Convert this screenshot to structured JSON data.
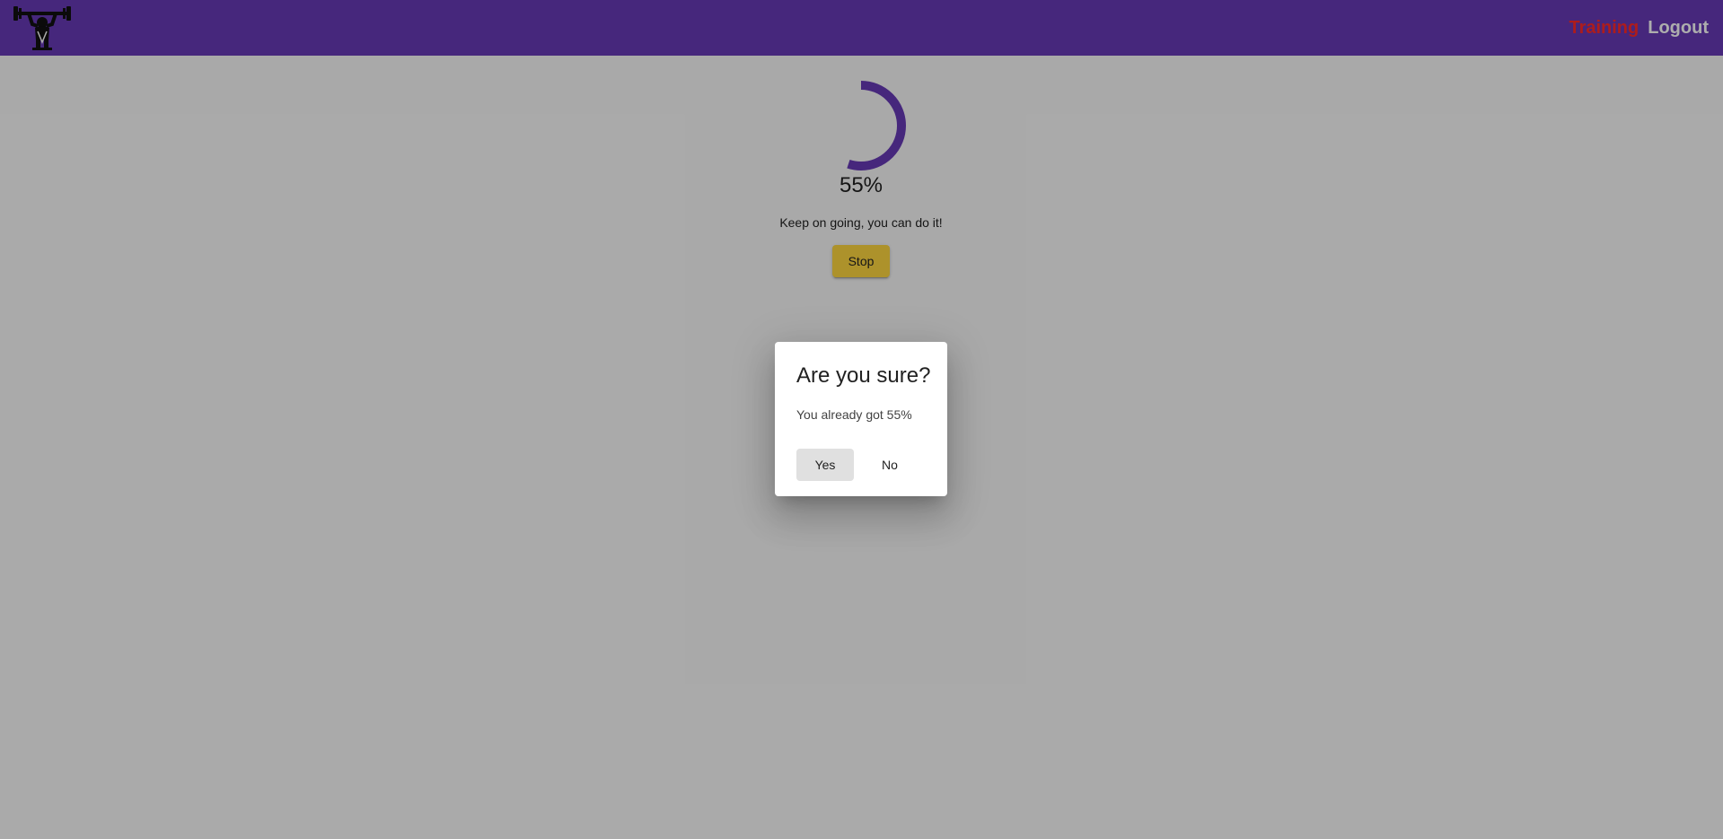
{
  "header": {
    "logo_icon": "weightlifter-logo",
    "nav": {
      "training_label": "Training",
      "logout_label": "Logout"
    },
    "colors": {
      "toolbar": "#673ab7",
      "training_link": "#ff2a2a",
      "logout_link": "#ffffff"
    }
  },
  "training": {
    "progress": 55,
    "progress_text": "55%",
    "message": "Keep on going, you can do it!",
    "stop_label": "Stop",
    "colors": {
      "spinner": "#673ab7",
      "stop_button": "#ffd740"
    }
  },
  "dialog": {
    "title": "Are you sure?",
    "content": "You already got 55%",
    "yes_label": "Yes",
    "no_label": "No"
  }
}
